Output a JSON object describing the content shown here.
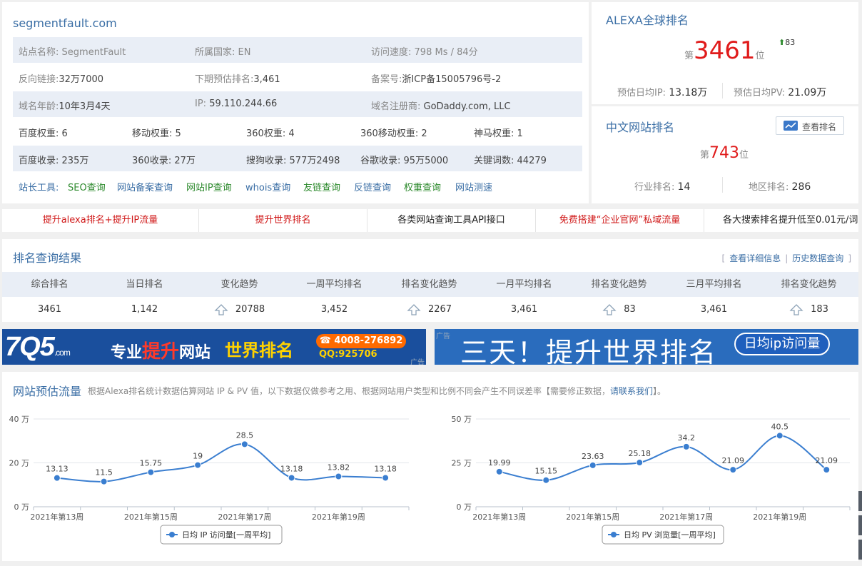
{
  "site": {
    "domain": "segmentfault.com",
    "rows": [
      [
        {
          "label": "站点名称:",
          "value": "SegmentFault"
        },
        {
          "label": "所属国家:",
          "value": "EN"
        },
        {
          "label": "访问速度:",
          "value": "798 Ms / 84分"
        }
      ],
      [
        {
          "label": "反向链接:",
          "value": "32万7000"
        },
        {
          "label": "下期预估排名:",
          "value": "3,461"
        },
        {
          "label": "备案号:",
          "value": "浙ICP备15005796号-2"
        }
      ],
      [
        {
          "label": "域名年龄:",
          "value": "10年3月4天"
        },
        {
          "label": "IP:",
          "value": "59.110.244.66"
        },
        {
          "label": "域名注册商:",
          "value": "GoDaddy.com, LLC"
        }
      ]
    ],
    "weights": [
      {
        "label": "百度权重:",
        "value": "6"
      },
      {
        "label": "移动权重:",
        "value": "5"
      },
      {
        "label": "360权重:",
        "value": "4"
      },
      {
        "label": "360移动权重:",
        "value": "2"
      },
      {
        "label": "神马权重:",
        "value": "1"
      }
    ],
    "indexes": [
      {
        "label": "百度收录:",
        "value": "235万"
      },
      {
        "label": "360收录:",
        "value": "27万"
      },
      {
        "label": "搜狗收录:",
        "value": "577万2498"
      },
      {
        "label": "谷歌收录:",
        "value": "95万5000"
      },
      {
        "label": "关键词数:",
        "value": "44279"
      }
    ],
    "tools_label": "站长工具:",
    "tools": [
      "SEO查询",
      "网站备案查询",
      "网站IP查询",
      "whois查询",
      "友链查询",
      "反链查询",
      "权重查询",
      "网站测速"
    ]
  },
  "alexa": {
    "title": "ALEXA全球排名",
    "prefix": "第",
    "rank": "3461",
    "suffix": "位",
    "change": "83",
    "ip_label": "预估日均IP:",
    "ip_value": "13.18万",
    "pv_label": "预估日均PV:",
    "pv_value": "21.09万"
  },
  "cn_rank": {
    "title": "中文网站排名",
    "button": "查看排名",
    "prefix": "第",
    "rank": "743",
    "suffix": "位",
    "industry_label": "行业排名:",
    "industry_value": "14",
    "region_label": "地区排名:",
    "region_value": "286"
  },
  "ad_links": [
    {
      "text": "提升alexa排名+提升IP流量",
      "color": "red"
    },
    {
      "text": "提升世界排名",
      "color": "red"
    },
    {
      "text": "各类网站查询工具API接口",
      "color": "black"
    },
    {
      "text": "免费搭建“企业官网”私域流量",
      "color": "red"
    },
    {
      "text": "各大搜索排名提升低至0.01元/词",
      "color": "black"
    }
  ],
  "rank_result": {
    "title": "排名查询结果",
    "link_detail": "查看详细信息",
    "link_history": "历史数据查询",
    "headers": [
      "综合排名",
      "当日排名",
      "变化趋势",
      "一周平均排名",
      "排名变化趋势",
      "一月平均排名",
      "排名变化趋势",
      "三月平均排名",
      "排名变化趋势"
    ],
    "values": [
      "3461",
      "1,142",
      "20788",
      "3,452",
      "2267",
      "3,461",
      "83",
      "3,461",
      "183"
    ]
  },
  "banners": {
    "left_logo": "7Q5",
    "left_logo_suffix": ".com",
    "left_text_a": "专业",
    "left_text_hl": "提升",
    "left_text_b": "网站",
    "left_text_c": "世界排名",
    "left_phone": "☎ 4008-276892",
    "left_qq": "QQ:925706",
    "ad_tag": "广告",
    "right_text": "三天！提升世界排名",
    "right_pill": "日均ip访问量"
  },
  "flow": {
    "title": "网站预估流量",
    "note": "根据Alexa排名统计数据估算网站 IP & PV 值，以下数据仅做参考之用、根据网站用户类型和比例不同会产生不同误差率【需要修正数据，",
    "note_link": "请联系我们",
    "note_end": "】。"
  },
  "chart_data": [
    {
      "type": "line",
      "x": [
        "2021年第13周",
        "2021年第14周",
        "2021年第15周",
        "2021年第16周",
        "2021年第17周",
        "2021年第18周",
        "2021年第19周",
        "2021年第20周"
      ],
      "x_tick_labels": [
        "2021年第13周",
        "2021年第15周",
        "2021年第17周",
        "2021年第19周"
      ],
      "series": [
        {
          "name": "日均 IP 访问量[一周平均]",
          "values": [
            13.13,
            11.5,
            15.75,
            19,
            28.5,
            13.18,
            13.82,
            13.18
          ]
        }
      ],
      "y_ticks": [
        "0 万",
        "20 万",
        "40 万"
      ],
      "ylim": [
        0,
        40
      ],
      "legend": "bottom-center",
      "grid": true,
      "color": "#3a7ed0"
    },
    {
      "type": "line",
      "x": [
        "2021年第13周",
        "2021年第14周",
        "2021年第15周",
        "2021年第16周",
        "2021年第17周",
        "2021年第18周",
        "2021年第19周",
        "2021年第20周"
      ],
      "x_tick_labels": [
        "2021年第13周",
        "2021年第15周",
        "2021年第17周",
        "2021年第19周"
      ],
      "series": [
        {
          "name": "日均 PV 浏览量[一周平均]",
          "values": [
            19.99,
            15.15,
            23.63,
            25.18,
            34.2,
            21.09,
            40.5,
            21.09
          ]
        }
      ],
      "y_ticks": [
        "0 万",
        "25 万",
        "50 万"
      ],
      "ylim": [
        0,
        50
      ],
      "legend": "bottom-center",
      "grid": true,
      "color": "#3a7ed0"
    }
  ]
}
